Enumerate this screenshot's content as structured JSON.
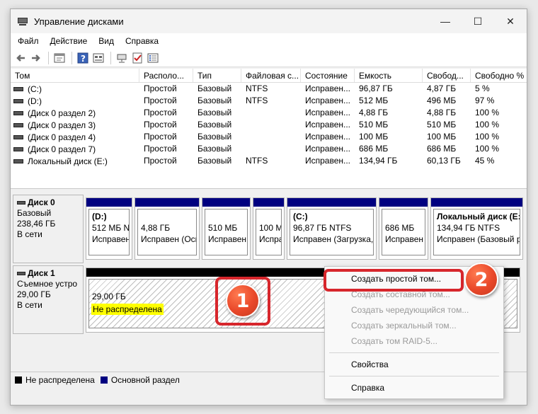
{
  "window": {
    "title": "Управление дисками",
    "controls": {
      "minimize": "—",
      "maximize": "☐",
      "close": "✕"
    }
  },
  "menu": [
    "Файл",
    "Действие",
    "Вид",
    "Справка"
  ],
  "toolbar_icons": [
    "back-icon",
    "forward-icon",
    "properties-icon",
    "help-icon",
    "view-icon",
    "connect-icon",
    "check-icon",
    "list-icon"
  ],
  "volume_list": {
    "columns": [
      "Том",
      "Располо...",
      "Тип",
      "Файловая с...",
      "Состояние",
      "Емкость",
      "Свобод...",
      "Свободно %"
    ],
    "rows": [
      [
        "(C:)",
        "Простой",
        "Базовый",
        "NTFS",
        "Исправен...",
        "96,87 ГБ",
        "4,87 ГБ",
        "5 %"
      ],
      [
        "(D:)",
        "Простой",
        "Базовый",
        "NTFS",
        "Исправен...",
        "512 МБ",
        "496 МБ",
        "97 %"
      ],
      [
        "(Диск 0 раздел 2)",
        "Простой",
        "Базовый",
        "",
        "Исправен...",
        "4,88 ГБ",
        "4,88 ГБ",
        "100 %"
      ],
      [
        "(Диск 0 раздел 3)",
        "Простой",
        "Базовый",
        "",
        "Исправен...",
        "510 МБ",
        "510 МБ",
        "100 %"
      ],
      [
        "(Диск 0 раздел 4)",
        "Простой",
        "Базовый",
        "",
        "Исправен...",
        "100 МБ",
        "100 МБ",
        "100 %"
      ],
      [
        "(Диск 0 раздел 7)",
        "Простой",
        "Базовый",
        "",
        "Исправен...",
        "686 МБ",
        "686 МБ",
        "100 %"
      ],
      [
        "Локальный диск (E:)",
        "Простой",
        "Базовый",
        "NTFS",
        "Исправен...",
        "134,94 ГБ",
        "60,13 ГБ",
        "45 %"
      ]
    ]
  },
  "disk0": {
    "name": "Диск 0",
    "type": "Базовый",
    "size": "238,46 ГБ",
    "status": "В сети",
    "partitions": [
      {
        "l1": "(D:)",
        "l2": "512 МБ NT",
        "l3": "Исправен"
      },
      {
        "l1": "",
        "l2": "4,88 ГБ",
        "l3": "Исправен (Осн"
      },
      {
        "l1": "",
        "l2": "510 МБ",
        "l3": "Исправен"
      },
      {
        "l1": "",
        "l2": "100 МБ",
        "l3": "Исправ"
      },
      {
        "l1": "(C:)",
        "l2": "96,87 ГБ NTFS",
        "l3": "Исправен (Загрузка,"
      },
      {
        "l1": "",
        "l2": "686 МБ",
        "l3": "Исправен"
      },
      {
        "l1": "Локальный диск  (E:)",
        "l2": "134,94 ГБ NTFS",
        "l3": "Исправен (Базовый ра"
      }
    ]
  },
  "disk1": {
    "name": "Диск 1",
    "type": "Съемное устро",
    "size": "29,00 ГБ",
    "status": "В сети",
    "unallocated": {
      "size": "29,00 ГБ",
      "status": "Не распределена"
    }
  },
  "legend": [
    {
      "label": "Не распределена",
      "color": "#000000"
    },
    {
      "label": "Основной раздел",
      "color": "#000080"
    }
  ],
  "context_menu": {
    "items": [
      {
        "label": "Создать простой том...",
        "enabled": true
      },
      {
        "label": "Создать составной том...",
        "enabled": false
      },
      {
        "label": "Создать чередующийся том...",
        "enabled": false
      },
      {
        "label": "Создать зеркальный том...",
        "enabled": false
      },
      {
        "label": "Создать том RAID-5...",
        "enabled": false
      },
      {
        "label": "Свойства",
        "enabled": true
      },
      {
        "label": "Справка",
        "enabled": true
      }
    ]
  },
  "annotations": {
    "badge1": "1",
    "badge2": "2",
    "accent": "#d7262c"
  }
}
